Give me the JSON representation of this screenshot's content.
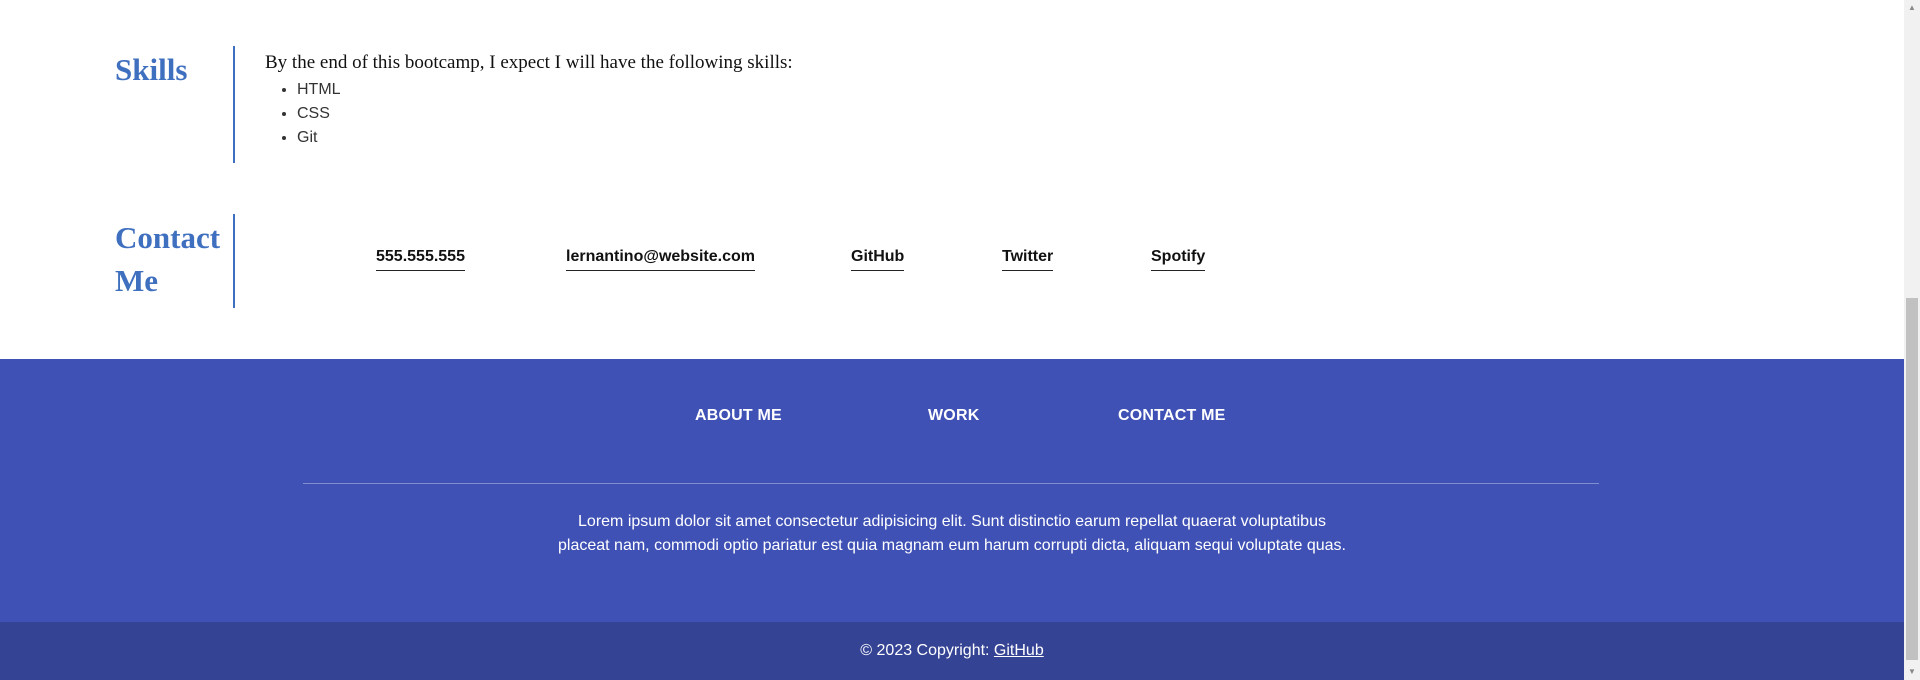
{
  "skills": {
    "title": "Skills",
    "intro": "By the end of this bootcamp, I expect I will have the following skills:",
    "items": [
      "HTML",
      "CSS",
      "Git"
    ]
  },
  "contact": {
    "title_line1": "Contact",
    "title_line2": "Me",
    "links": [
      {
        "label": "555.555.555"
      },
      {
        "label": "lernantino@website.com"
      },
      {
        "label": "GitHub"
      },
      {
        "label": "Twitter"
      },
      {
        "label": "Spotify"
      }
    ]
  },
  "footer": {
    "nav": [
      "ABOUT ME",
      "WORK",
      "CONTACT ME"
    ],
    "text_line1": "Lorem ipsum dolor sit amet consectetur adipisicing elit. Sunt distinctio earum repellat quaerat voluptatibus",
    "text_line2": "placeat nam, commodi optio pariatur est quia magnam eum harum corrupti dicta, aliquam sequi voluptate quas.",
    "copyright_prefix": "© 2023 Copyright: ",
    "copyright_link": "GitHub"
  },
  "colors": {
    "accent": "#3f6fbf",
    "footer_bg": "#3f51b5",
    "copyright_bg": "#354395"
  }
}
